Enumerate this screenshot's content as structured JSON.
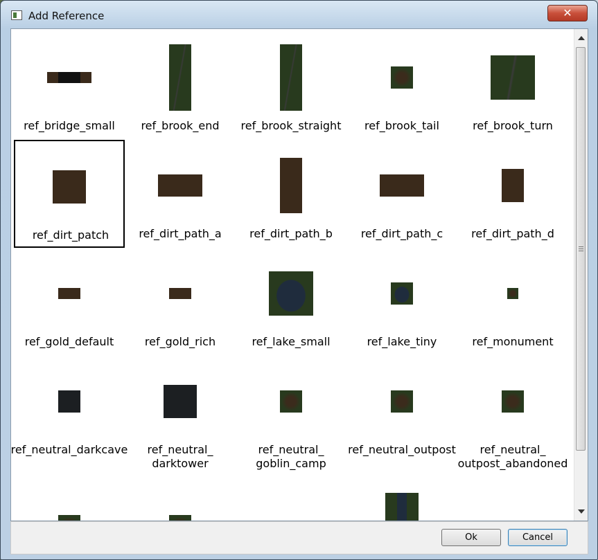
{
  "window": {
    "title": "Add Reference",
    "close_glyph": "✕",
    "title_icon": "dialog-window-icon"
  },
  "references": [
    {
      "label": "ref_bridge_small",
      "thumb_style": "bridge"
    },
    {
      "label": "ref_brook_end",
      "thumb_style": "brook"
    },
    {
      "label": "ref_brook_straight",
      "thumb_style": "brook"
    },
    {
      "label": "ref_brook_tail",
      "thumb_style": "grass"
    },
    {
      "label": "ref_brook_turn",
      "thumb_style": "brook"
    },
    {
      "label": "ref_dirt_patch",
      "thumb_style": "dirt",
      "selected": true
    },
    {
      "label": "ref_dirt_path_a",
      "thumb_style": "dirt"
    },
    {
      "label": "ref_dirt_path_b",
      "thumb_style": "dirt"
    },
    {
      "label": "ref_dirt_path_c",
      "thumb_style": "dirt"
    },
    {
      "label": "ref_dirt_path_d",
      "thumb_style": "dirt"
    },
    {
      "label": "ref_gold_default",
      "thumb_style": "dirt"
    },
    {
      "label": "ref_gold_rich",
      "thumb_style": "dirt"
    },
    {
      "label": "ref_lake_small",
      "thumb_style": "lake"
    },
    {
      "label": "ref_lake_tiny",
      "thumb_style": "lake"
    },
    {
      "label": "ref_monument",
      "thumb_style": "grass"
    },
    {
      "label": "ref_neutral_darkcave",
      "thumb_style": "dark"
    },
    {
      "label": "ref_neutral_\ndarktower",
      "thumb_style": "dark"
    },
    {
      "label": "ref_neutral_\ngoblin_camp",
      "thumb_style": "grass"
    },
    {
      "label": "ref_neutral_outpost",
      "thumb_style": "grass"
    },
    {
      "label": "ref_neutral_\noutpost_abandoned",
      "thumb_style": "grass"
    },
    {
      "label": "",
      "thumb_style": "grass"
    },
    {
      "label": "",
      "thumb_style": "grass"
    },
    {
      "label": "",
      "thumb_style": "dark"
    },
    {
      "label": "",
      "thumb_style": "river"
    }
  ],
  "buttons": {
    "ok_label": "Ok",
    "cancel_label": "Cancel"
  },
  "colors": {
    "selection_border": "#000000",
    "close_button": "#c9503b",
    "dirt": "#3a2a1b",
    "grass": "#283a1e",
    "water": "#1f2c3d"
  }
}
